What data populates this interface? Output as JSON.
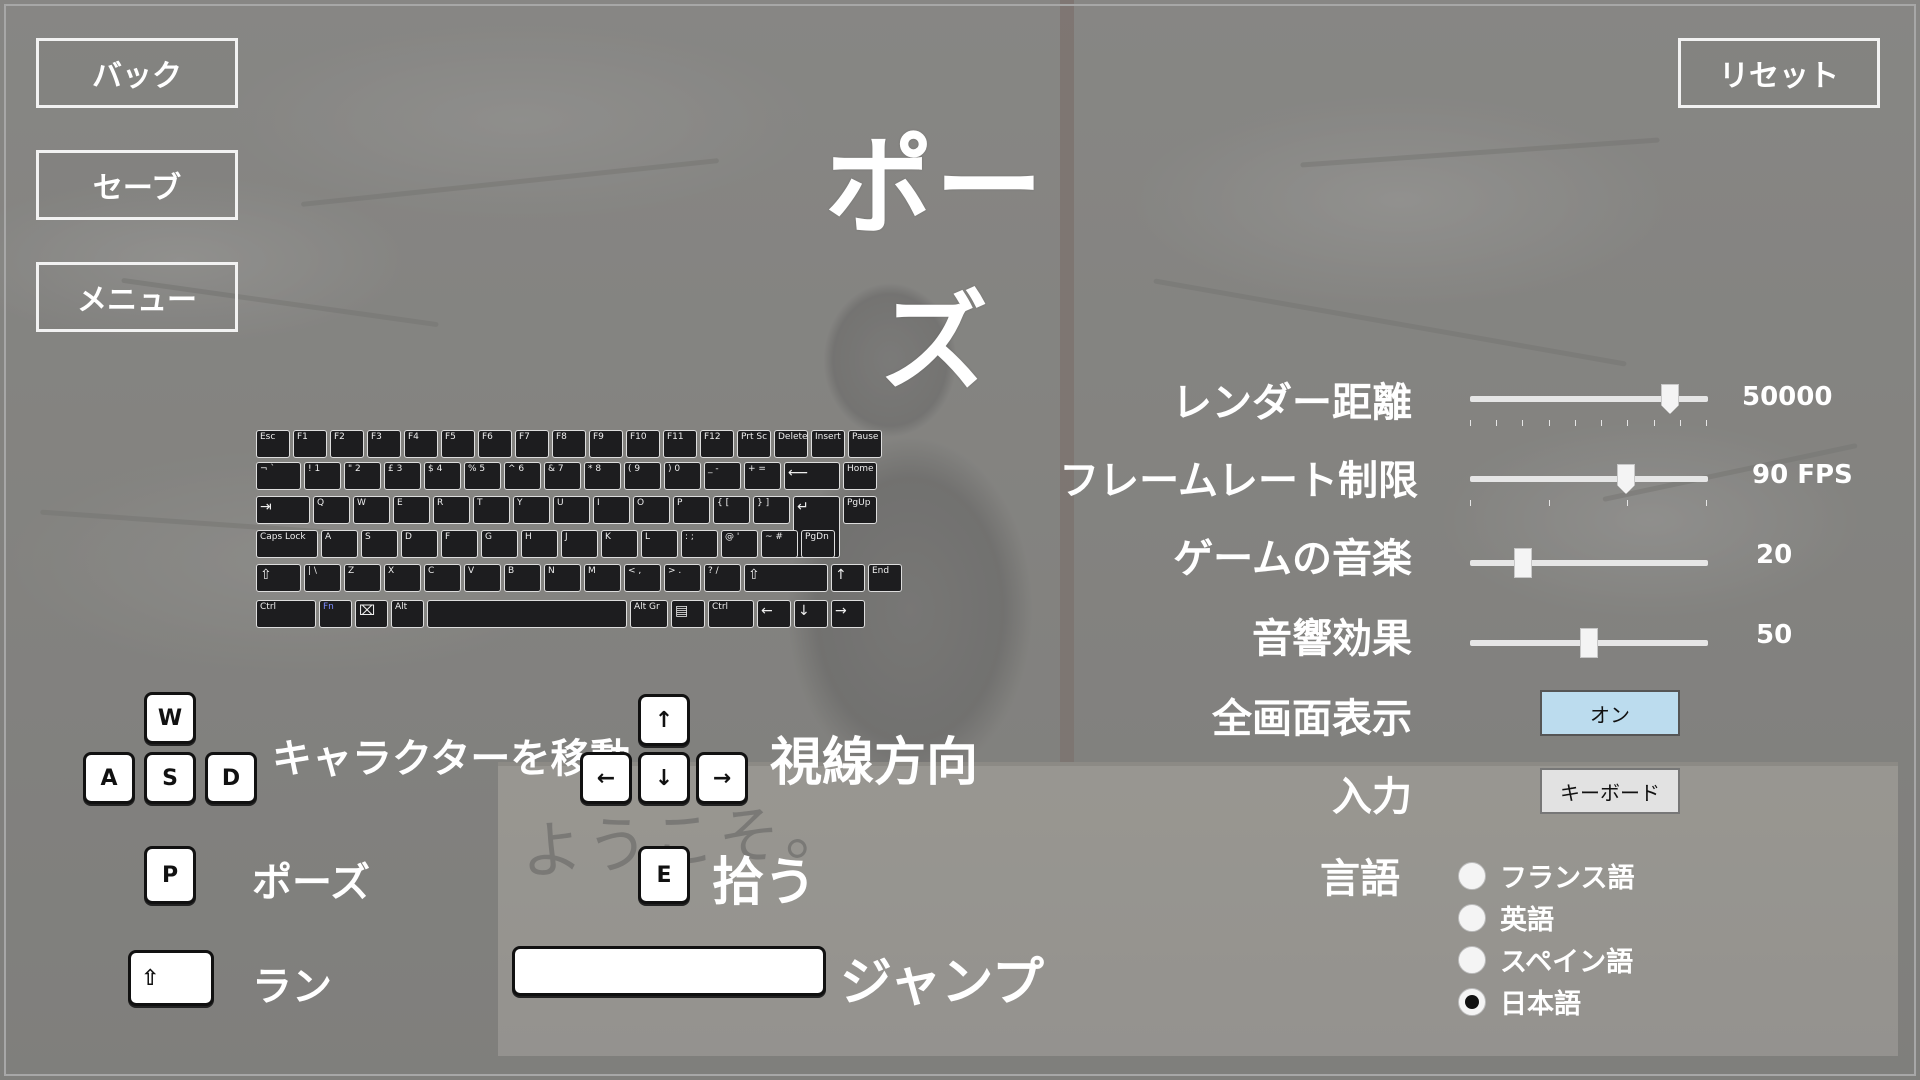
{
  "menu": {
    "back": "バック",
    "save": "セーブ",
    "menu": "メニュー",
    "reset": "リセット"
  },
  "title": "ポーズ",
  "background": {
    "sign_text": "ようこそ。"
  },
  "keyboard": {
    "rows": [
      [
        "Esc",
        "F1",
        "F2",
        "F3",
        "F4",
        "F5",
        "F6",
        "F7",
        "F8",
        "F9",
        "F10",
        "F11",
        "F12",
        "Prt Sc",
        "Delete",
        "Insert",
        "Pause Break"
      ],
      [
        "¬ `",
        "! 1",
        "\" 2",
        "£ 3",
        "$ 4",
        "% 5",
        "^ 6",
        "& 7",
        "* 8",
        "( 9",
        ") 0",
        "_ -",
        "+ =",
        "⟵",
        "Home"
      ],
      [
        "⇥",
        "Q",
        "W",
        "E",
        "R",
        "T",
        "Y",
        "U",
        "I",
        "O",
        "P",
        "{ [",
        "} ]",
        "↵",
        "PgUp"
      ],
      [
        "Caps Lock",
        "A",
        "S",
        "D",
        "F",
        "G",
        "H",
        "J",
        "K",
        "L",
        ": ;",
        "@ '",
        "~ #",
        "PgDn"
      ],
      [
        "⇧",
        "| \\",
        "Z",
        "X",
        "C",
        "V",
        "B",
        "N",
        "M",
        "< ,",
        "> .",
        "? /",
        "⇧",
        "↑",
        "End"
      ],
      [
        "Ctrl",
        "Fn",
        "⌧",
        "Alt",
        "",
        "Alt Gr",
        "▤",
        "Ctrl",
        "←",
        "↓",
        "→"
      ]
    ]
  },
  "controls": {
    "move_keys": [
      "W",
      "A",
      "S",
      "D"
    ],
    "move_label": "キャラクターを移動",
    "look_keys": [
      "↑",
      "←",
      "↓",
      "→"
    ],
    "look_label": "視線方向",
    "pause_key": "P",
    "pause_label": "ポーズ",
    "pickup_key": "E",
    "pickup_label": "拾う",
    "run_key": "⇧",
    "run_label": "ラン",
    "jump_key": "",
    "jump_label": "ジャンプ"
  },
  "settings": {
    "render_distance": {
      "label": "レンダー距離",
      "value_text": "50000",
      "fraction": 0.87
    },
    "frame_limit": {
      "label": "フレームレート制限",
      "value_text": "90 FPS",
      "fraction": 0.67
    },
    "music": {
      "label": "ゲームの音楽",
      "value_text": "20",
      "fraction": 0.2
    },
    "sfx": {
      "label": "音響効果",
      "value_text": "50",
      "fraction": 0.5
    },
    "fullscreen": {
      "label": "全画面表示",
      "button": "オン",
      "color": "#bcdcee"
    },
    "input": {
      "label": "入力",
      "button": "キーボード",
      "color": "#e2e2e2"
    },
    "language": {
      "label": "言語",
      "options": [
        "フランス語",
        "英語",
        "スペイン語",
        "日本語"
      ],
      "selected": "日本語"
    }
  }
}
